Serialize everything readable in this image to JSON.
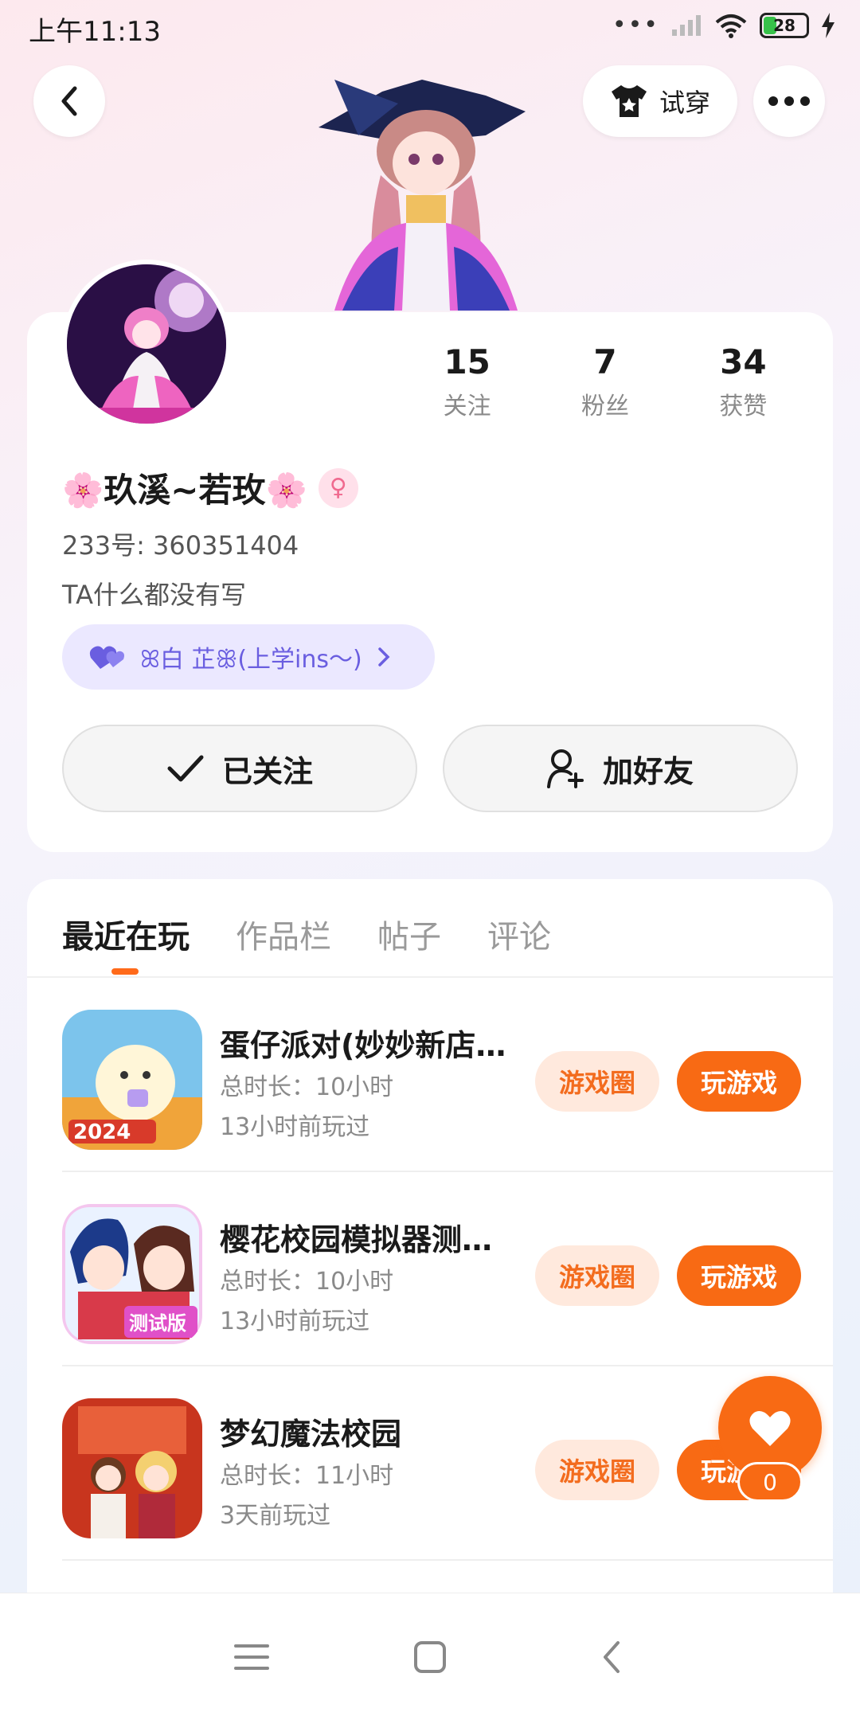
{
  "status_bar": {
    "time": "上午11:13",
    "battery": "28"
  },
  "header": {
    "tryon_label": "试穿"
  },
  "profile": {
    "stats": [
      {
        "value": "15",
        "label": "关注"
      },
      {
        "value": "7",
        "label": "粉丝"
      },
      {
        "value": "34",
        "label": "获赞"
      }
    ],
    "nickname": "🌸玖溪~若玫🌸",
    "gender_symbol": "♀",
    "uid": "233号: 360351404",
    "bio": "TA什么都没有写",
    "relation": "ꕤ白 芷ꕥ(上学ins～)",
    "follow_label": "已关注",
    "add_friend_label": "加好友"
  },
  "tabs": [
    {
      "label": "最近在玩",
      "active": true
    },
    {
      "label": "作品栏",
      "active": false
    },
    {
      "label": "帖子",
      "active": false
    },
    {
      "label": "评论",
      "active": false
    }
  ],
  "games": [
    {
      "title": "蛋仔派对(妙妙新店…",
      "duration": "总时长：10小时",
      "last_played": "13小时前玩过",
      "circle_label": "游戏圈",
      "play_label": "玩游戏"
    },
    {
      "title": "樱花校园模拟器测…",
      "duration": "总时长：10小时",
      "last_played": "13小时前玩过",
      "circle_label": "游戏圈",
      "play_label": "玩游戏"
    },
    {
      "title": "梦幻魔法校园",
      "duration": "总时长：11小时",
      "last_played": "3天前玩过",
      "circle_label": "游戏圈",
      "play_label": "玩游戏"
    }
  ],
  "like_fab": {
    "count": "0"
  },
  "colors": {
    "accent": "#f86a14",
    "accent_light": "#ffe9dd",
    "relation_bg": "#ebe8ff",
    "relation_text": "#6a5ee0"
  }
}
